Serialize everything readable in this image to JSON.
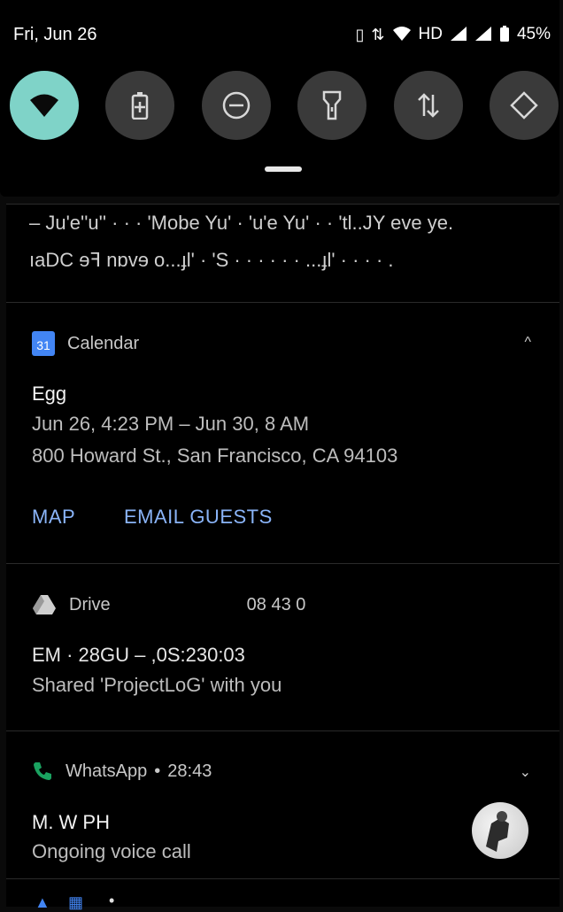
{
  "status_bar": {
    "date": "Fri, Jun 26",
    "network_label": "HD",
    "battery": "45%"
  },
  "quick_settings": {
    "tiles": [
      {
        "icon": "wifi-icon",
        "active": true
      },
      {
        "icon": "battery-saver-icon",
        "active": false
      },
      {
        "icon": "do-not-disturb-icon",
        "active": false
      },
      {
        "icon": "flashlight-icon",
        "active": false
      },
      {
        "icon": "data-transfer-icon",
        "active": false
      },
      {
        "icon": "auto-rotate-icon",
        "active": false
      }
    ]
  },
  "scrambled_notification": {
    "line1": "– Ju'e''u''  ·  ·  ·  'Mobe Yu'  ·  'u'e Yu'  ·  ·  'tl..JY eve ye.",
    "line2": "ıaDC ɘꟻ nɒvɘ o...ɟl'  ·  'S  ·  ·  ·  ·  ·  ·  ...ɟl'  ·  ·  ·  ·  ."
  },
  "calendar": {
    "app_name": "Calendar",
    "icon_day": "31",
    "title": "Egg",
    "time": "Jun 26, 4:23 PM – Jun 30, 8 AM",
    "location": "800 Howard St., San Francisco, CA 94103",
    "actions": {
      "map": "MAP",
      "email_guests": "EMAIL GUESTS"
    },
    "chevron": "^"
  },
  "drive": {
    "app_name": "Drive",
    "header_extra": "08   43   0",
    "line1": "EM · 28GU – ,0S:230:03",
    "body": "Shared 'ProjectLoG' with you"
  },
  "whatsapp": {
    "app_name": "WhatsApp",
    "time": "28:43",
    "contact": "M.  W  PH",
    "status": "Ongoing voice call",
    "chevron": "⌄"
  },
  "colors": {
    "accent_tile": "#7fd3c8",
    "link": "#8ab4f8",
    "calendar_blue": "#4285f4",
    "whatsapp_green": "#1aa260"
  }
}
